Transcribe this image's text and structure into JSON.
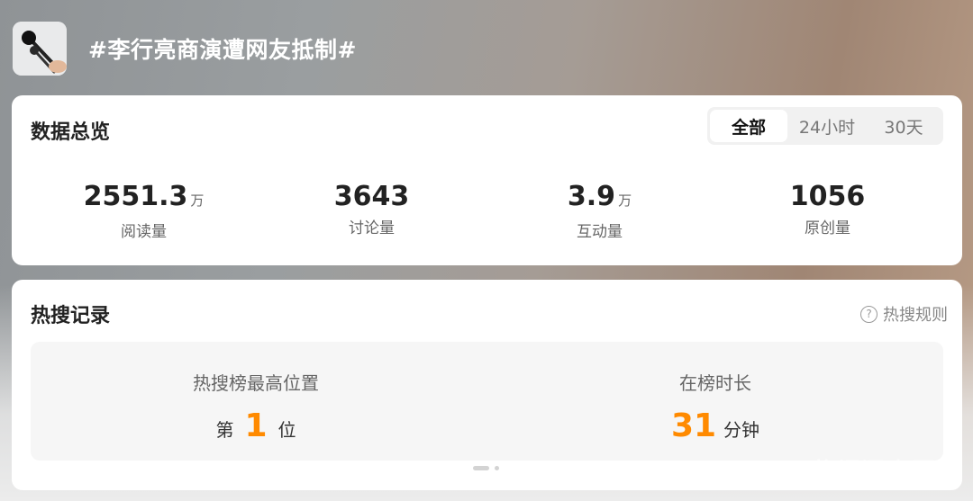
{
  "topic": {
    "title": "#李行亮商演遭网友抵制#"
  },
  "overview": {
    "title": "数据总览",
    "tabs": [
      {
        "label": "全部",
        "active": true
      },
      {
        "label": "24小时",
        "active": false
      },
      {
        "label": "30天",
        "active": false
      }
    ],
    "stats": [
      {
        "value": "2551.3",
        "unit": "万",
        "label": "阅读量"
      },
      {
        "value": "3643",
        "unit": "",
        "label": "讨论量"
      },
      {
        "value": "3.9",
        "unit": "万",
        "label": "互动量"
      },
      {
        "value": "1056",
        "unit": "",
        "label": "原创量"
      }
    ]
  },
  "hot": {
    "title": "热搜记录",
    "rules_label": "热搜规则",
    "rules_icon": "question-circle-icon",
    "highest": {
      "label": "热搜榜最高位置",
      "prefix": "第",
      "value": "1",
      "suffix": "位"
    },
    "duration": {
      "label": "在榜时长",
      "value": "31",
      "suffix": "分钟"
    }
  },
  "colors": {
    "accent": "#ff8a00"
  },
  "watermark": "荣耀渭南园"
}
